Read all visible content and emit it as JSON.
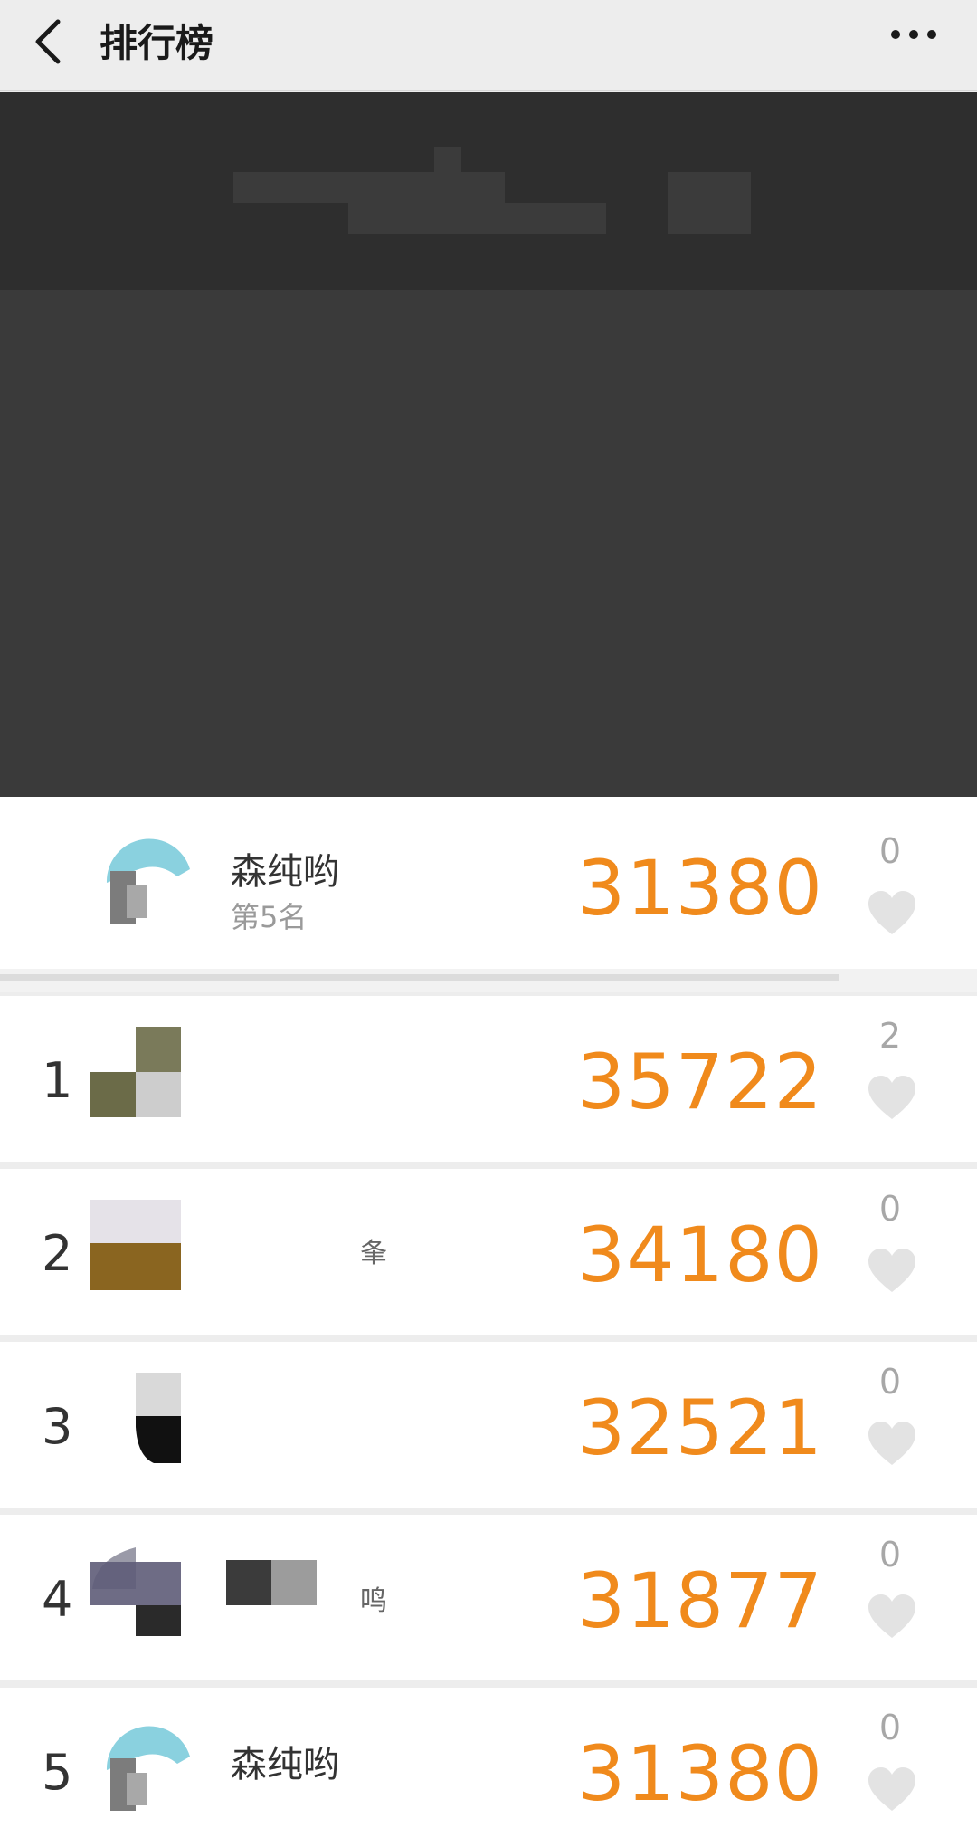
{
  "nav": {
    "title": "排行榜",
    "back_icon": "chevron-left-icon",
    "more_icon": "more-dots-icon"
  },
  "my_rank": {
    "name": "森纯哟",
    "rank_text": "第5名",
    "score": "31380",
    "likes": "0"
  },
  "leaderboard": [
    {
      "rank": "1",
      "name": "",
      "score": "35722",
      "likes": "2"
    },
    {
      "rank": "2",
      "name": "",
      "name_fragment": "夆",
      "score": "34180",
      "likes": "0"
    },
    {
      "rank": "3",
      "name": "",
      "score": "32521",
      "likes": "0"
    },
    {
      "rank": "4",
      "name": "",
      "name_fragment": "鸣",
      "score": "31877",
      "likes": "0"
    },
    {
      "rank": "5",
      "name": "森纯哟",
      "score": "31380",
      "likes": "0"
    }
  ],
  "colors": {
    "score": "#f08a1c",
    "likes": "#a7a7a7",
    "background": "#ededed",
    "banner": "#3a3a3a"
  }
}
